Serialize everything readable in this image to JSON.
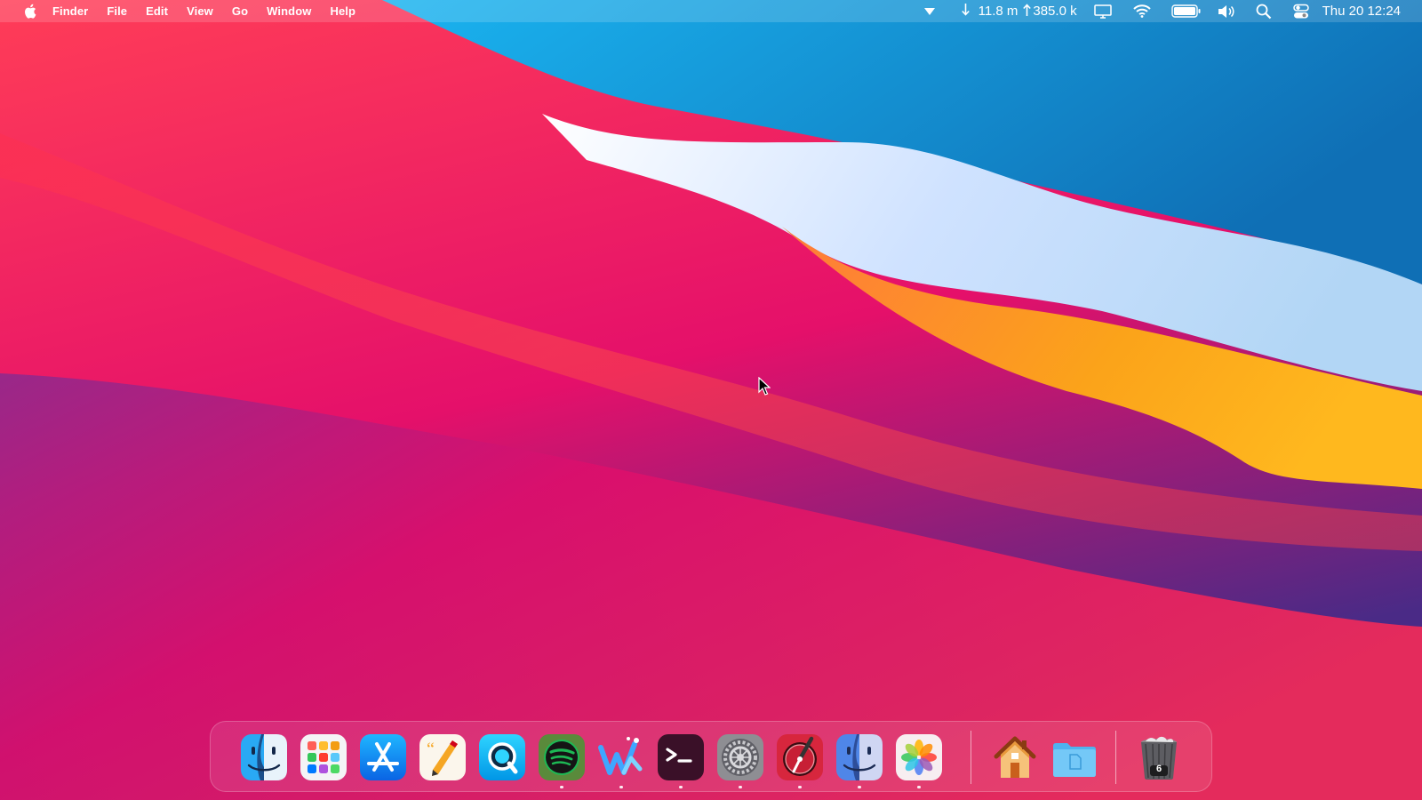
{
  "menubar": {
    "apple_icon": "apple-logo-icon",
    "items": [
      "Finder",
      "File",
      "Edit",
      "View",
      "Go",
      "Window",
      "Help"
    ],
    "network": {
      "download": "11.8 m",
      "upload": "385.0 k"
    },
    "clock": "Thu 20  12:24",
    "icons": [
      "dropdown-arrow-icon",
      "download-arrow-icon",
      "upload-arrow-icon",
      "display-icon",
      "wifi-icon",
      "battery-icon",
      "volume-icon",
      "spotlight-search-icon",
      "control-center-icon"
    ]
  },
  "dock": {
    "apps": [
      {
        "name": "Finder",
        "icon": "finder-icon",
        "running": false
      },
      {
        "name": "Launchpad",
        "icon": "launchpad-icon",
        "running": false
      },
      {
        "name": "App Store",
        "icon": "app-store-icon",
        "running": false
      },
      {
        "name": "Pages",
        "icon": "pages-icon",
        "running": false
      },
      {
        "name": "QuickTime Player",
        "icon": "quicktime-icon",
        "running": false
      },
      {
        "name": "Spotify",
        "icon": "spotify-icon",
        "running": true
      },
      {
        "name": "Writer",
        "icon": "writer-icon",
        "running": true
      },
      {
        "name": "Terminal",
        "icon": "terminal-icon",
        "running": true
      },
      {
        "name": "System Preferences",
        "icon": "system-preferences-icon",
        "running": true
      },
      {
        "name": "Compass",
        "icon": "compass-icon",
        "running": true
      },
      {
        "name": "Finder",
        "icon": "finder-face-icon",
        "running": true
      },
      {
        "name": "Photos",
        "icon": "photos-icon",
        "running": true
      },
      {
        "name": "Home",
        "icon": "home-folder-icon",
        "running": false
      },
      {
        "name": "Documents",
        "icon": "documents-folder-icon",
        "running": false
      },
      {
        "name": "Trash",
        "icon": "trash-icon",
        "running": false
      }
    ],
    "trash_count": "6"
  },
  "colors": {
    "wallpaper_red": "#f4364a",
    "wallpaper_blue": "#1596d6",
    "wallpaper_orange": "#f7a319",
    "wallpaper_magenta": "#d8106a"
  }
}
